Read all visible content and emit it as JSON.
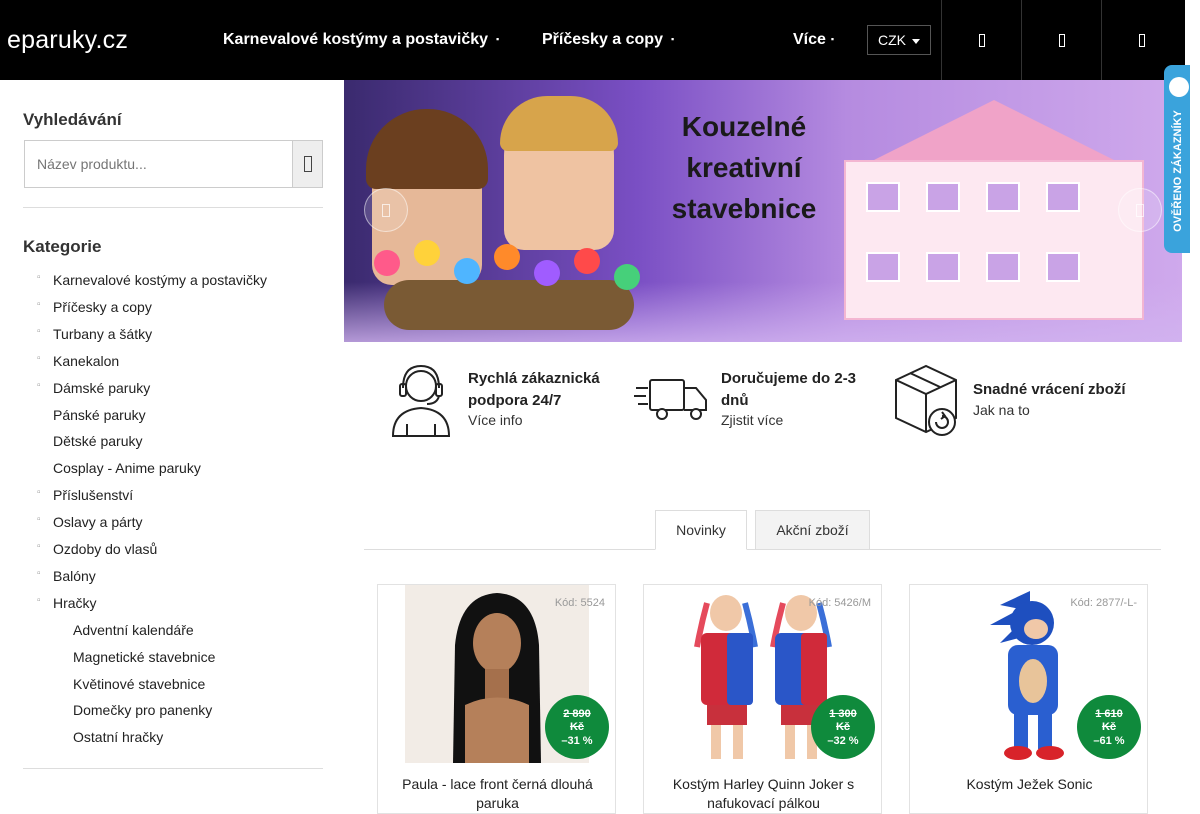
{
  "header": {
    "logo": "eparuky.cz",
    "nav": [
      {
        "label": "Karnevalové kostýmy a postavičky"
      },
      {
        "label": "Příčesky a copy"
      },
      {
        "label": "Více"
      }
    ],
    "currency": "CZK",
    "icons": [
      "user-icon",
      "search-icon",
      "cart-icon"
    ]
  },
  "sidebar": {
    "search_title": "Vyhledávání",
    "search_placeholder": "Název produktu...",
    "categories_title": "Kategorie",
    "categories": [
      {
        "label": "Karnevalové kostýmy a postavičky",
        "bullet": true,
        "level": 0
      },
      {
        "label": "Příčesky a copy",
        "bullet": true,
        "level": 0
      },
      {
        "label": "Turbany a šátky",
        "bullet": true,
        "level": 0
      },
      {
        "label": "Kanekalon",
        "bullet": true,
        "level": 0
      },
      {
        "label": "Dámské paruky",
        "bullet": true,
        "level": 0
      },
      {
        "label": "Pánské paruky",
        "bullet": false,
        "level": 0
      },
      {
        "label": "Dětské paruky",
        "bullet": false,
        "level": 0
      },
      {
        "label": "Cosplay - Anime paruky",
        "bullet": false,
        "level": 0
      },
      {
        "label": "Příslušenství",
        "bullet": true,
        "level": 0
      },
      {
        "label": "Oslavy a párty",
        "bullet": true,
        "level": 0
      },
      {
        "label": "Ozdoby do vlasů",
        "bullet": true,
        "level": 0
      },
      {
        "label": "Balóny",
        "bullet": true,
        "level": 0
      },
      {
        "label": "Hračky",
        "bullet": true,
        "level": 0
      },
      {
        "label": "Adventní kalendáře",
        "bullet": false,
        "level": 1
      },
      {
        "label": "Magnetické stavebnice",
        "bullet": false,
        "level": 1
      },
      {
        "label": "Květinové stavebnice",
        "bullet": false,
        "level": 1
      },
      {
        "label": "Domečky pro panenky",
        "bullet": false,
        "level": 1
      },
      {
        "label": "Ostatní hračky",
        "bullet": false,
        "level": 1
      }
    ]
  },
  "banner": {
    "title_line1": "Kouzelné",
    "title_line2": "kreativní",
    "title_line3": "stavebnice"
  },
  "badge": {
    "text": "OVĚŘENO ZÁKAZNÍKY"
  },
  "benefits": [
    {
      "title1": "Rychlá zákaznická",
      "title2": "podpora 24/7",
      "link": "Více info",
      "icon": "headset-icon"
    },
    {
      "title1": "Doručujeme do 2-3",
      "title2": "dnů",
      "link": "Zjistit více",
      "icon": "delivery-truck-icon"
    },
    {
      "title1": "Snadné vrácení zboží",
      "title2": "",
      "link": "Jak na to",
      "icon": "return-box-icon"
    }
  ],
  "tabs": [
    {
      "label": "Novinky",
      "active": true
    },
    {
      "label": "Akční zboží",
      "active": false
    }
  ],
  "products": [
    {
      "code": "Kód: 5524",
      "old_price": "2 890",
      "currency": "Kč",
      "discount": "–31 %",
      "name_line1": "Paula - lace front černá dlouhá",
      "name_line2": "paruka"
    },
    {
      "code": "Kód: 5426/M",
      "old_price": "1 300",
      "currency": "Kč",
      "discount": "–32 %",
      "name_line1": "Kostým Harley Quinn Joker s",
      "name_line2": "nafukovací pálkou"
    },
    {
      "code": "Kód: 2877/-L-",
      "old_price": "1 610",
      "currency": "Kč",
      "discount": "–61 %",
      "name_line1": "Kostým Ježek Sonic",
      "name_line2": ""
    }
  ],
  "colors": {
    "header_bg": "#000000",
    "discount_badge": "#0f8a3c",
    "verified_badge": "#3aa3dc"
  }
}
